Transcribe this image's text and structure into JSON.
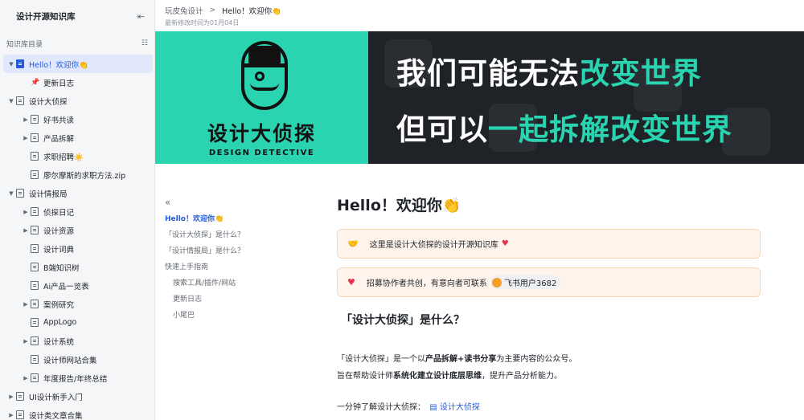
{
  "sidebar": {
    "title": "设计开源知识库",
    "section_label": "知识库目录",
    "items": [
      {
        "label": "Hello！欢迎你👏",
        "level": 0,
        "arrow": "▼",
        "active": true
      },
      {
        "label": "更新日志",
        "level": 1,
        "pin": true
      },
      {
        "label": "设计大侦探",
        "level": 0,
        "arrow": "▼"
      },
      {
        "label": "好书共读",
        "level": 1,
        "arrow": "▶"
      },
      {
        "label": "产品拆解",
        "level": 1,
        "arrow": "▶"
      },
      {
        "label": "求职招聘☀️",
        "level": 1,
        "arrow": ""
      },
      {
        "label": "廖尔摩斯的求职方法.zip",
        "level": 1,
        "arrow": ""
      },
      {
        "label": "设计情报局",
        "level": 0,
        "arrow": "▼"
      },
      {
        "label": "侦探日记",
        "level": 1,
        "arrow": "▶"
      },
      {
        "label": "设计资源",
        "level": 1,
        "arrow": "▶"
      },
      {
        "label": "设计词典",
        "level": 1,
        "arrow": ""
      },
      {
        "label": "B端知识树",
        "level": 1,
        "arrow": ""
      },
      {
        "label": "Ai产品一览表",
        "level": 1,
        "arrow": ""
      },
      {
        "label": "案例研究",
        "level": 1,
        "arrow": "▶"
      },
      {
        "label": "AppLogo",
        "level": 1,
        "arrow": ""
      },
      {
        "label": "设计系统",
        "level": 1,
        "arrow": "▶"
      },
      {
        "label": "设计师网站合集",
        "level": 1,
        "arrow": ""
      },
      {
        "label": "年度报告/年终总结",
        "level": 1,
        "arrow": "▶"
      },
      {
        "label": "UI设计新手入门",
        "level": 0,
        "arrow": "▶"
      },
      {
        "label": "设计类文章合集",
        "level": 0,
        "arrow": "▶"
      }
    ]
  },
  "topbar": {
    "crumb_root": "玩皮兔设计",
    "crumb_sep": ">",
    "crumb_current": "Hello！欢迎你👏",
    "modified": "最新修改时间为01月04日"
  },
  "banner": {
    "cn_name": "设计大侦探",
    "en_name": "DESIGN DETECTIVE",
    "line1_plain": "我们可能无法",
    "line1_highlight": "改变世界",
    "line2_plain": "但可以",
    "line2_highlight": "一起拆解改变世界"
  },
  "outline": {
    "collapse_icon": "«",
    "items": [
      {
        "label": "Hello！欢迎你👏",
        "current": true,
        "sub": false
      },
      {
        "label": "「设计大侦探」是什么？",
        "current": false,
        "sub": false
      },
      {
        "label": "「设计情报局」是什么？",
        "current": false,
        "sub": false
      },
      {
        "label": "快速上手指南",
        "current": false,
        "sub": false
      },
      {
        "label": "搜索工具/插件/网站",
        "current": false,
        "sub": true
      },
      {
        "label": "更新日志",
        "current": false,
        "sub": true
      },
      {
        "label": "小尾巴",
        "current": false,
        "sub": true
      }
    ]
  },
  "doc": {
    "title": "Hello！欢迎你👏",
    "callout1_icon": "🤝",
    "callout1_text": "这里是设计大侦探的设计开源知识库",
    "callout1_heart": "♥",
    "callout2_icon": "♥",
    "callout2_text": "招募协作者共创，有意向者可联系",
    "mention_name": "飞书用户3682",
    "h2": "「设计大侦探」是什么？",
    "p1_a": "「设计大侦探」是一个以",
    "p1_b": "产品拆解+读书分享",
    "p1_c": "为主要内容的公众号。",
    "p2_a": "旨在帮助设计师",
    "p2_b": "系统化建立设计底层思维",
    "p2_c": "，提升产品分析能力。",
    "p3_a": "一分钟了解设计大侦探：",
    "p3_link": "设计大侦探"
  },
  "colors": {
    "accent": "#245bdb",
    "brand_teal": "#2bd4b1",
    "callout_bg": "#fef4ec"
  }
}
